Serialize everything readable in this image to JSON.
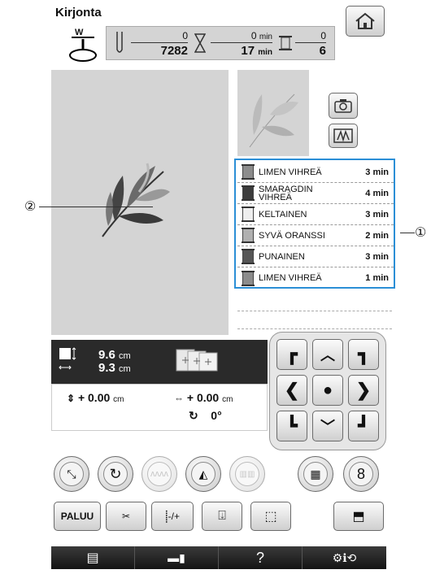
{
  "header": {
    "title": "Kirjonta"
  },
  "status": {
    "presser_label": "W",
    "stitch_done": "0",
    "stitch_total": "7282",
    "time_done": "0",
    "time_done_unit": "min",
    "time_total": "17",
    "time_total_unit": "min",
    "color_done": "0",
    "color_total": "6"
  },
  "threads": [
    {
      "name": "LIMEN VIHREÄ",
      "time": "3 min",
      "color": "#8c8c8c"
    },
    {
      "name": "SMARAGDIN VIHREÄ",
      "time": "4 min",
      "color": "#3c3c3c"
    },
    {
      "name": "KELTAINEN",
      "time": "3 min",
      "color": "#eeeeee"
    },
    {
      "name": "SYVÄ ORANSSI",
      "time": "2 min",
      "color": "#b0b0b0"
    },
    {
      "name": "PUNAINEN",
      "time": "3 min",
      "color": "#555555"
    },
    {
      "name": "LIMEN VIHREÄ",
      "time": "1 min",
      "color": "#8c8c8c"
    }
  ],
  "size": {
    "height": "9.6",
    "width": "9.3",
    "unit": "cm"
  },
  "position": {
    "vertical": "+ 0.00",
    "horizontal": "+ 0.00",
    "unit": "cm",
    "angle": "0°"
  },
  "callouts": {
    "one": "①",
    "two": "②"
  },
  "buttons": {
    "back": "PALUU",
    "needle_adjust": "-/+",
    "help": "?"
  },
  "icons": [
    "home-icon",
    "camera-icon",
    "pattern-view-icon",
    "arrow-icon",
    "size-icon",
    "rotate-icon",
    "density-icon",
    "mirror-icon",
    "color-sort-icon",
    "thread-trim-icon",
    "number-8-icon",
    "cut-jump-icon",
    "needle-icon",
    "start-icon",
    "trial-icon",
    "memory-icon",
    "manual-icon",
    "sewing-icon",
    "settings-icon"
  ]
}
